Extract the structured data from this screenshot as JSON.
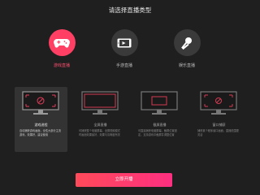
{
  "title": "请选择直播类型",
  "types": [
    {
      "label": "游戏直播",
      "icon": "gamepad-icon"
    },
    {
      "label": "手游直播",
      "icon": "tablet-icon"
    },
    {
      "label": "娱乐直播",
      "icon": "microphone-icon"
    }
  ],
  "modes": [
    {
      "name": "游戏进程",
      "desc": "自动捕获游戏画面，全性大部分主流游戏，效果好，建议使用"
    },
    {
      "name": "全屏直播",
      "desc": "可捕获整个电脑屏幕，全屏视频模式时画面效果最好，效果与清晰度有关"
    },
    {
      "name": "截屏直播",
      "desc": "可直接捕获电脑屏幕，截屏位置固定，支持游戏中截屏并调整位置"
    },
    {
      "name": "窗口捕获",
      "desc": "捕获某个程序窗口画面，直播范围更灵活"
    }
  ],
  "start_label": "立即开播",
  "colors": {
    "accent": "#ff3f64",
    "background": "#1f1f1f"
  }
}
